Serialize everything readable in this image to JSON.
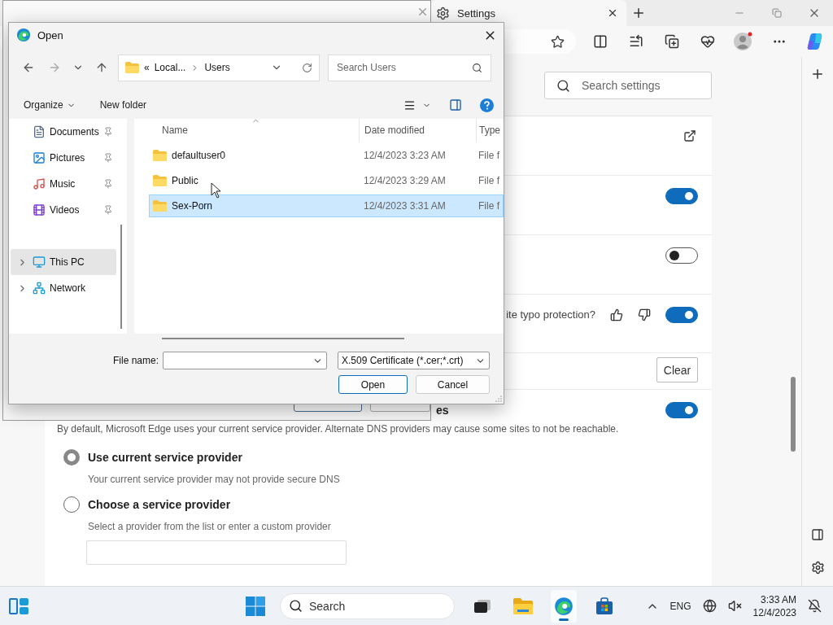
{
  "browser": {
    "tab": {
      "title": "Settings"
    },
    "search": {
      "placeholder": "Search settings"
    }
  },
  "settings": {
    "rows": [
      {
        "kind": "link"
      },
      {
        "kind": "toggle",
        "on": true
      },
      {
        "kind": "toggle",
        "on": false
      },
      {
        "kind": "feedback",
        "text": "ite typo protection?",
        "on": true
      },
      {
        "kind": "button",
        "label": "Clear"
      },
      {
        "kind": "section",
        "title": "es",
        "on": true
      }
    ]
  },
  "dns": {
    "description": "By default, Microsoft Edge uses your current service provider. Alternate DNS providers may cause some sites to not be reachable.",
    "options": [
      {
        "label": "Use current service provider",
        "hint": "Your current service provider may not provide secure DNS",
        "selected": true
      },
      {
        "label": "Choose a service provider",
        "hint": "Select a provider from the list or enter a custom provider",
        "selected": false
      }
    ]
  },
  "dialog": {
    "title": "Open",
    "breadcrumb": [
      "«",
      "Local...",
      "Users"
    ],
    "search": {
      "placeholder": "Search Users"
    },
    "commands": [
      "Organize",
      "New folder"
    ],
    "nav": [
      {
        "label": "Documents",
        "pinned": true,
        "expandable": false,
        "selected": false
      },
      {
        "label": "Pictures",
        "pinned": true,
        "expandable": false,
        "selected": false
      },
      {
        "label": "Music",
        "pinned": true,
        "expandable": false,
        "selected": false
      },
      {
        "label": "Videos",
        "pinned": true,
        "expandable": false,
        "selected": false
      },
      {
        "label": "This PC",
        "pinned": false,
        "expandable": true,
        "selected": true
      },
      {
        "label": "Network",
        "pinned": false,
        "expandable": true,
        "selected": false
      }
    ],
    "columns": [
      "Name",
      "Date modified",
      "Type"
    ],
    "files": [
      {
        "name": "defaultuser0",
        "date": "12/4/2023 3:23 AM",
        "type": "File f",
        "selected": false
      },
      {
        "name": "Public",
        "date": "12/4/2023 3:29 AM",
        "type": "File f",
        "selected": false
      },
      {
        "name": "Sex-Porn",
        "date": "12/4/2023 3:31 AM",
        "type": "File f",
        "selected": true
      }
    ],
    "file_name_label": "File name:",
    "file_type": "X.509 Certificate (*.cer;*.crt)",
    "buttons": [
      "Open",
      "Cancel"
    ]
  },
  "taskbar": {
    "search": "Search",
    "apps": [
      {
        "active": false
      },
      {
        "active": false
      },
      {
        "active": true
      },
      {
        "active": false
      }
    ],
    "language": "ENG",
    "time": "3:33 AM",
    "date": "12/4/2023"
  }
}
